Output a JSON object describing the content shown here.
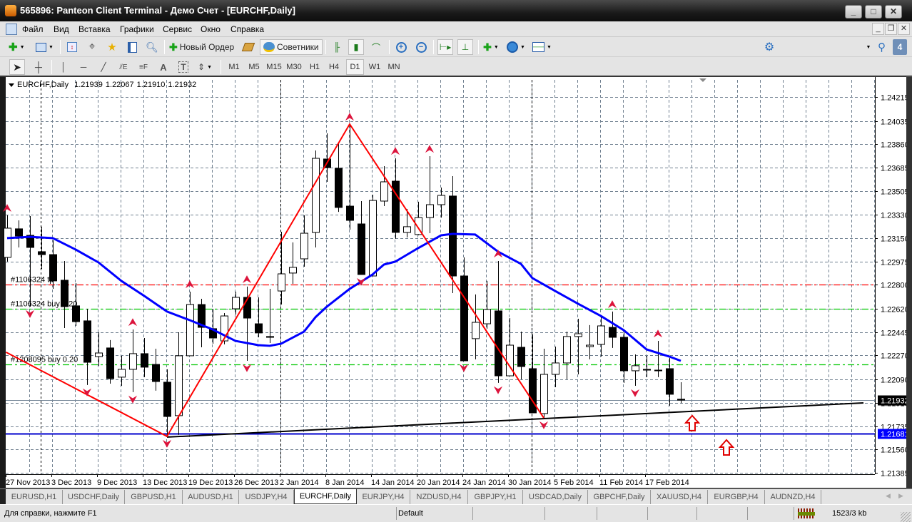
{
  "window": {
    "title": "565896: Panteon Client Terminal - Демо Счет - [EURCHF,Daily]"
  },
  "menu": [
    "Файл",
    "Вид",
    "Вставка",
    "Графики",
    "Сервис",
    "Окно",
    "Справка"
  ],
  "toolbar": {
    "new_order_label": "Новый Ордер",
    "advisors_label": "Советники",
    "search_placeholder": "",
    "badge_count": "4"
  },
  "timeframes": [
    "M1",
    "M5",
    "M15",
    "M30",
    "H1",
    "H4",
    "D1",
    "W1",
    "MN"
  ],
  "active_timeframe": "D1",
  "tabs": [
    {
      "label": "EURUSD,H1"
    },
    {
      "label": "USDCHF,Daily"
    },
    {
      "label": "GBPUSD,H1"
    },
    {
      "label": "AUDUSD,H1"
    },
    {
      "label": "USDJPY,H4"
    },
    {
      "label": "EURCHF,Daily",
      "active": true
    },
    {
      "label": "EURJPY,H4"
    },
    {
      "label": "NZDUSD,H4"
    },
    {
      "label": "GBPJPY,H1"
    },
    {
      "label": "USDCAD,Daily"
    },
    {
      "label": "GBPCHF,Daily"
    },
    {
      "label": "XAUUSD,H4"
    },
    {
      "label": "EURGBP,H4"
    },
    {
      "label": "AUDNZD,H4"
    }
  ],
  "status": {
    "help": "Для справки, нажмите F1",
    "profile": "Default",
    "traffic": "1523/3 kb"
  },
  "colors": {
    "bull": "#ffffff",
    "bear": "#000000",
    "ma": "#0000ff",
    "zigzag": "#ff0000",
    "fractal": "#dc143c",
    "tp": "#ff0000",
    "buy": "#00c800",
    "hline": "#0000cc",
    "grid": "#708090"
  },
  "chart_data": {
    "type": "candlestick",
    "header": {
      "symbol": "EURCHF,Daily",
      "open": "1.21939",
      "high": "1.22067",
      "low": "1.21910",
      "close": "1.21932"
    },
    "ylim": [
      1.21385,
      1.24215
    ],
    "price_ticks": [
      "1.24215",
      "1.24035",
      "1.23860",
      "1.23685",
      "1.23505",
      "1.23330",
      "1.23150",
      "1.22975",
      "1.22800",
      "1.22620",
      "1.22445",
      "1.22270",
      "1.22090",
      "1.21910",
      "1.21735",
      "1.21560",
      "1.21385"
    ],
    "date_labels": [
      {
        "bar": 0,
        "label": "27 Nov 2013"
      },
      {
        "bar": 4,
        "label": "3 Dec 2013"
      },
      {
        "bar": 8,
        "label": "9 Dec 2013"
      },
      {
        "bar": 12,
        "label": "13 Dec 2013"
      },
      {
        "bar": 16,
        "label": "19 Dec 2013"
      },
      {
        "bar": 20,
        "label": "26 Dec 2013"
      },
      {
        "bar": 24,
        "label": "2 Jan 2014"
      },
      {
        "bar": 28,
        "label": "8 Jan 2014"
      },
      {
        "bar": 32,
        "label": "14 Jan 2014"
      },
      {
        "bar": 36,
        "label": "20 Jan 2014"
      },
      {
        "bar": 40,
        "label": "24 Jan 2014"
      },
      {
        "bar": 44,
        "label": "30 Jan 2014"
      },
      {
        "bar": 48,
        "label": "5 Feb 2014"
      },
      {
        "bar": 52,
        "label": "11 Feb 2014"
      },
      {
        "bar": 56,
        "label": "17 Feb 2014"
      }
    ],
    "period_separators": [
      3,
      24,
      46
    ],
    "ohlc": [
      [
        1.23007,
        1.23324,
        1.22975,
        1.23227
      ],
      [
        1.23222,
        1.23286,
        1.23082,
        1.23168
      ],
      [
        1.23173,
        1.23318,
        1.22636,
        1.23082
      ],
      [
        1.2305,
        1.23238,
        1.22921,
        1.23028
      ],
      [
        1.23028,
        1.23136,
        1.2277,
        1.2283
      ],
      [
        1.22835,
        1.2298,
        1.22475,
        1.22636
      ],
      [
        1.22642,
        1.22813,
        1.22491,
        1.22523
      ],
      [
        1.22529,
        1.2262,
        1.22046,
        1.22217
      ],
      [
        1.2226,
        1.22443,
        1.22191,
        1.22287
      ],
      [
        1.22325,
        1.22384,
        1.22056,
        1.22094
      ],
      [
        1.22105,
        1.22266,
        1.2204,
        1.22164
      ],
      [
        1.22164,
        1.22464,
        1.21992,
        1.22282
      ],
      [
        1.22282,
        1.224,
        1.22105,
        1.2218
      ],
      [
        1.22201,
        1.22319,
        1.22003,
        1.22072
      ],
      [
        1.22067,
        1.22164,
        1.21659,
        1.21809
      ],
      [
        1.21815,
        1.22443,
        1.2167,
        1.22266
      ],
      [
        1.22266,
        1.22749,
        1.22266,
        1.22652
      ],
      [
        1.22652,
        1.22695,
        1.2233,
        1.2248
      ],
      [
        1.2247,
        1.2262,
        1.22357,
        1.224
      ],
      [
        1.22378,
        1.22588,
        1.22352,
        1.22566
      ],
      [
        1.2262,
        1.22749,
        1.22577,
        1.22706
      ],
      [
        1.22706,
        1.22787,
        1.22228,
        1.2255
      ],
      [
        1.22507,
        1.22706,
        1.22405,
        1.22438
      ],
      [
        1.22411,
        1.2277,
        1.22362,
        1.22405
      ],
      [
        1.22754,
        1.232,
        1.22652,
        1.22883
      ],
      [
        1.22889,
        1.2312,
        1.22808,
        1.22932
      ],
      [
        1.22996,
        1.23324,
        1.22937,
        1.23189
      ],
      [
        1.23195,
        1.23812,
        1.23082,
        1.23753
      ],
      [
        1.23748,
        1.23941,
        1.23576,
        1.23683
      ],
      [
        1.23678,
        1.23871,
        1.2335,
        1.23383
      ],
      [
        1.23393,
        1.24011,
        1.23216,
        1.23286
      ],
      [
        1.23259,
        1.23431,
        1.22878,
        1.22878
      ],
      [
        1.22867,
        1.23479,
        1.22867,
        1.23436
      ],
      [
        1.23431,
        1.23694,
        1.23393,
        1.23576
      ],
      [
        1.23581,
        1.23753,
        1.23146,
        1.23195
      ],
      [
        1.23195,
        1.23372,
        1.23157,
        1.23238
      ],
      [
        1.23179,
        1.23426,
        1.23173,
        1.23307
      ],
      [
        1.23307,
        1.23769,
        1.23189,
        1.23404
      ],
      [
        1.23404,
        1.23533,
        1.23307,
        1.23474
      ],
      [
        1.23469,
        1.23619,
        1.22738,
        1.22867
      ],
      [
        1.22867,
        1.23007,
        1.22228,
        1.22228
      ],
      [
        1.22395,
        1.22728,
        1.22239,
        1.22518
      ],
      [
        1.22507,
        1.2283,
        1.2247,
        1.22615
      ],
      [
        1.22604,
        1.2298,
        1.22062,
        1.22115
      ],
      [
        1.22115,
        1.2255,
        1.22115,
        1.22346
      ],
      [
        1.2233,
        1.22448,
        1.22088,
        1.22185
      ],
      [
        1.22169,
        1.22427,
        1.21836,
        1.21836
      ],
      [
        1.21831,
        1.22319,
        1.21798,
        1.22126
      ],
      [
        1.22126,
        1.22335,
        1.22029,
        1.22212
      ],
      [
        1.22212,
        1.22448,
        1.22088,
        1.22411
      ],
      [
        1.22411,
        1.22545,
        1.22126,
        1.22432
      ],
      [
        1.22335,
        1.22497,
        1.22239,
        1.22346
      ],
      [
        1.22352,
        1.22566,
        1.2226,
        1.22491
      ],
      [
        1.2248,
        1.22599,
        1.22325,
        1.22405
      ],
      [
        1.22405,
        1.22443,
        1.22062,
        1.22153
      ],
      [
        1.22153,
        1.22276,
        1.2204,
        1.22191
      ],
      [
        1.22164,
        1.22266,
        1.22105,
        1.22158
      ],
      [
        1.22158,
        1.22378,
        1.22105,
        1.22153
      ],
      [
        1.22169,
        1.2225,
        1.2189,
        1.21976
      ],
      [
        1.21939,
        1.22067,
        1.2191,
        1.21932
      ]
    ],
    "moving_average": [
      [
        0,
        1.23152
      ],
      [
        2,
        1.23162
      ],
      [
        4,
        1.23152
      ],
      [
        6,
        1.23066
      ],
      [
        8,
        1.22969
      ],
      [
        10,
        1.2283
      ],
      [
        12,
        1.22717
      ],
      [
        14,
        1.22599
      ],
      [
        16,
        1.22534
      ],
      [
        18,
        1.22464
      ],
      [
        20,
        1.22378
      ],
      [
        22,
        1.22346
      ],
      [
        23,
        1.22341
      ],
      [
        24,
        1.22357
      ],
      [
        26,
        1.22448
      ],
      [
        27,
        1.22556
      ],
      [
        28,
        1.22636
      ],
      [
        30,
        1.2277
      ],
      [
        32,
        1.22878
      ],
      [
        33,
        1.22953
      ],
      [
        34,
        1.22975
      ],
      [
        36,
        1.23077
      ],
      [
        38,
        1.23173
      ],
      [
        39,
        1.23184
      ],
      [
        41,
        1.23179
      ],
      [
        43,
        1.2305
      ],
      [
        45,
        1.22958
      ],
      [
        46,
        1.22851
      ],
      [
        48,
        1.22754
      ],
      [
        50,
        1.22658
      ],
      [
        52,
        1.22566
      ],
      [
        54,
        1.22459
      ],
      [
        56,
        1.22314
      ],
      [
        58,
        1.2226
      ],
      [
        59,
        1.22228
      ]
    ],
    "zigzag": [
      [
        -0.1,
        1.22293
      ],
      [
        14,
        1.21659
      ],
      [
        30,
        1.24011
      ],
      [
        47,
        1.21798
      ]
    ],
    "fractals_up": [
      0,
      11,
      16,
      21,
      30,
      34,
      37,
      43,
      53,
      57
    ],
    "fractals_down": [
      2,
      7,
      11,
      14,
      21,
      31,
      40,
      43,
      47,
      55
    ],
    "trendline": [
      [
        14,
        1.21659
      ],
      [
        75,
        1.21911
      ]
    ],
    "horizontal_line": {
      "price": 1.21681,
      "label": "1.21681"
    },
    "bid_line": {
      "price": 1.21932,
      "label": "1.21932"
    },
    "order_lines": [
      {
        "price": 1.228,
        "label": "#1106324 tp",
        "kind": "tp"
      },
      {
        "price": 1.2262,
        "label": "#1106324 buy 0.20",
        "kind": "buy"
      },
      {
        "price": 1.222,
        "label": "#1208095 buy 0.20",
        "kind": "buy"
      }
    ],
    "arrow_objects": [
      [
        60,
        1.21815
      ],
      [
        63,
        1.21632
      ]
    ]
  }
}
